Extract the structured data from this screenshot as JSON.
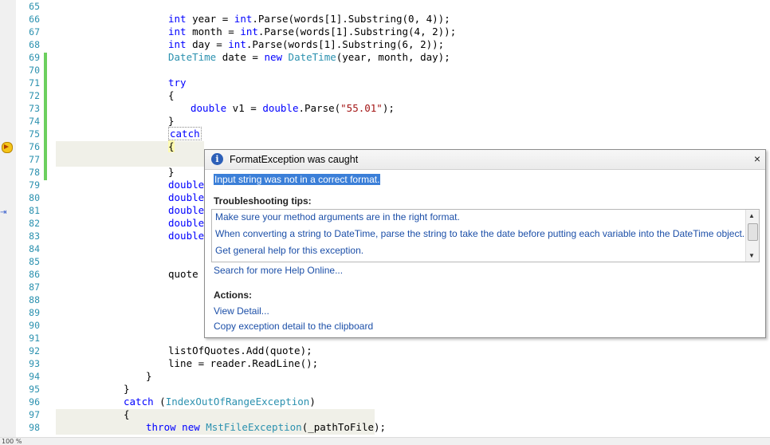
{
  "editor": {
    "line_numbers": [
      "65",
      "66",
      "67",
      "68",
      "69",
      "70",
      "71",
      "72",
      "73",
      "74",
      "75",
      "76",
      "77",
      "78",
      "79",
      "80",
      "81",
      "82",
      "83",
      "84",
      "85",
      "86",
      "87",
      "88",
      "89",
      "90",
      "91",
      "92",
      "93",
      "94",
      "95",
      "96",
      "97",
      "98"
    ],
    "code": {
      "l66": {
        "kw": "int",
        "rest": " year = ",
        "kw2": "int",
        "rest2": ".Parse(words[1].Substring(0, 4));"
      },
      "l67": {
        "kw": "int",
        "rest": " month = ",
        "kw2": "int",
        "rest2": ".Parse(words[1].Substring(4, 2));"
      },
      "l68": {
        "kw": "int",
        "rest": " day = ",
        "kw2": "int",
        "rest2": ".Parse(words[1].Substring(6, 2));"
      },
      "l69": {
        "ty": "DateTime",
        "rest": " date = ",
        "kw": "new",
        "ty2": " DateTime",
        "rest2": "(year, month, day);"
      },
      "l71": {
        "kw": "try"
      },
      "l72": {
        "text": "{"
      },
      "l73": {
        "kw": "double",
        "rest": " v1 = ",
        "kw2": "double",
        "rest2": ".Parse(",
        "st": "\"55.01\"",
        "rest3": ");"
      },
      "l74": {
        "text": "}"
      },
      "l75": {
        "kw": "catch"
      },
      "l76": {
        "text": "{"
      },
      "l78": {
        "text": "}"
      },
      "l79": {
        "kw": "double"
      },
      "l80": {
        "kw": "double"
      },
      "l81": {
        "kw": "double"
      },
      "l82": {
        "kw": "double"
      },
      "l83": {
        "kw": "double"
      },
      "l86": {
        "text": "quote ="
      },
      "l92": {
        "text": "listOfQuotes.Add(quote);"
      },
      "l93": {
        "text": "line = reader.ReadLine();"
      },
      "l94": {
        "text": "}"
      },
      "l95": {
        "text": "}"
      },
      "l96": {
        "kw": "catch",
        "rest": " (",
        "ty": "IndexOutOfRangeException",
        "rest2": ")"
      },
      "l97": {
        "text": "{"
      },
      "l98": {
        "kw": "throw",
        "rest": " ",
        "kw2": "new",
        "ty": " MstFileException",
        "rest2": "(_pathToFile);"
      }
    },
    "zoom": "100 %"
  },
  "exception_helper": {
    "title": "FormatException was caught",
    "close": "×",
    "message": "Input string was not in a correct format.",
    "tips_heading": "Troubleshooting tips:",
    "tips": [
      "Make sure your method arguments are in the right format.",
      "When converting a string to DateTime, parse the string to take the date before putting each variable into the DateTime object.",
      "Get general help for this exception."
    ],
    "search_link": "Search for more Help Online...",
    "actions_heading": "Actions:",
    "actions": [
      "View Detail...",
      "Copy exception detail to the clipboard"
    ]
  },
  "colors": {
    "keyword": "#0000ff",
    "type": "#2b91af",
    "string": "#a31515",
    "linenum": "#2b91af",
    "changebar": "#6ccf5e"
  }
}
